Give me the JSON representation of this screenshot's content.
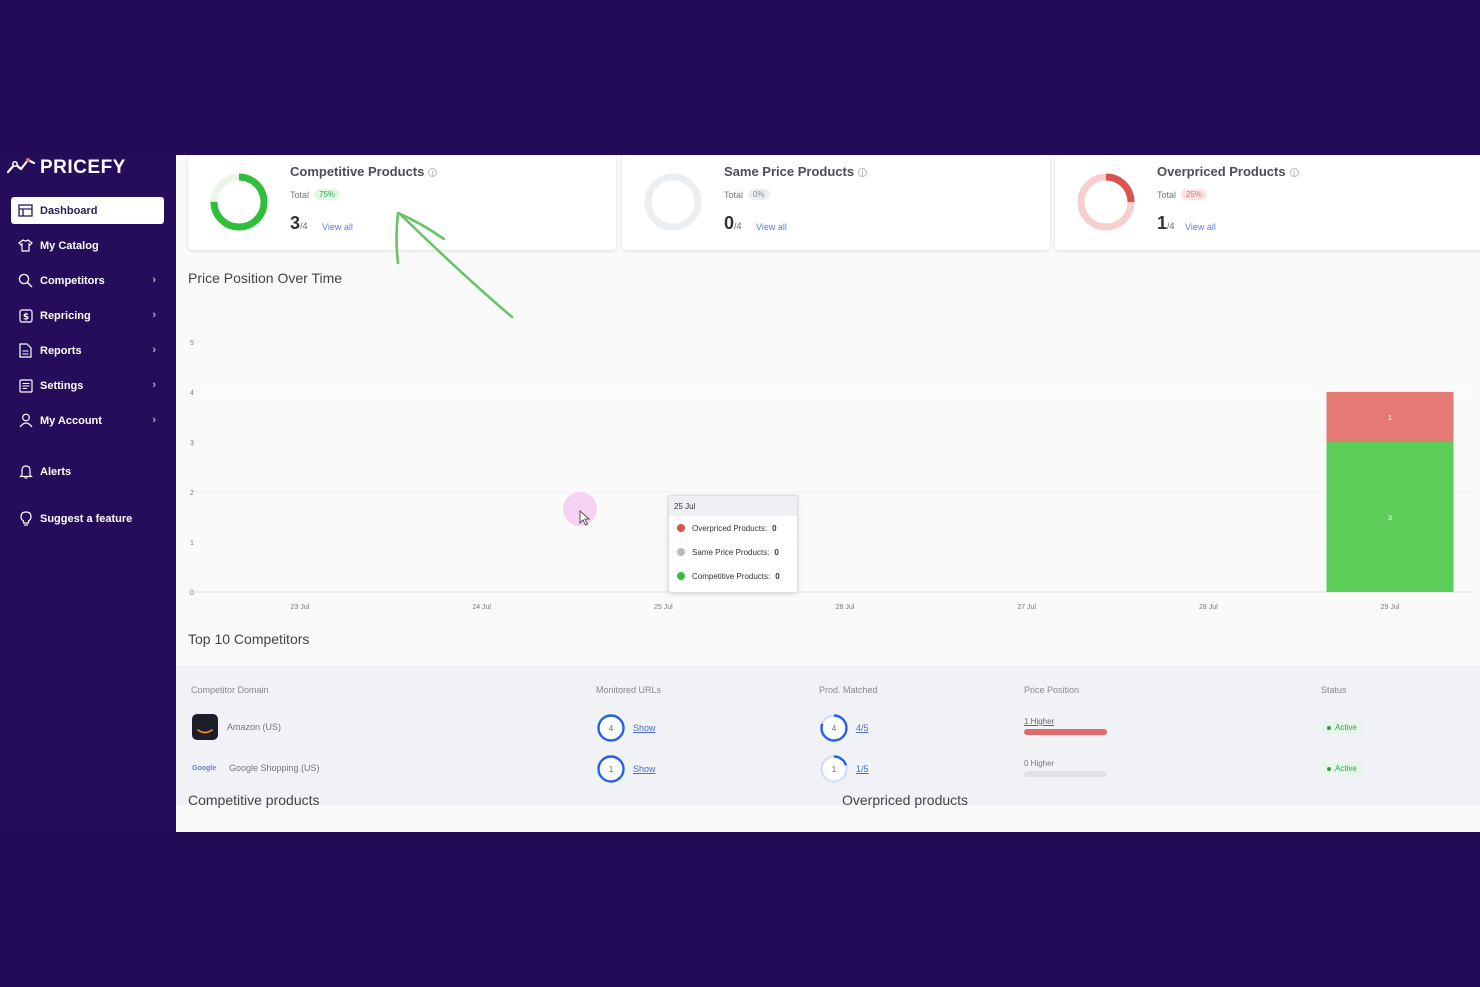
{
  "brand": {
    "name": "PRICEFY"
  },
  "sidebar": {
    "items": [
      {
        "label": "Dashboard",
        "icon": "dashboard-icon",
        "active": true,
        "chevron": false
      },
      {
        "label": "My Catalog",
        "icon": "shirt-icon",
        "chevron": false
      },
      {
        "label": "Competitors",
        "icon": "magnifier-icon",
        "chevron": true
      },
      {
        "label": "Repricing",
        "icon": "dollar-icon",
        "chevron": true
      },
      {
        "label": "Reports",
        "icon": "document-icon",
        "chevron": true
      },
      {
        "label": "Settings",
        "icon": "settings-list-icon",
        "chevron": true
      },
      {
        "label": "My Account",
        "icon": "user-icon",
        "chevron": true
      }
    ],
    "alerts": "Alerts",
    "suggest": "Suggest a feature"
  },
  "cards": [
    {
      "title": "Competitive Products",
      "total_label": "Total",
      "pct": "75%",
      "count": "3",
      "of": "/4",
      "view_all": "View all",
      "ring_fraction": 0.75,
      "color": "#2fbf3a",
      "pill_bg": "#e2f7e6",
      "pill_fg": "#3aa856"
    },
    {
      "title": "Same Price Products",
      "total_label": "Total",
      "pct": "0%",
      "count": "0",
      "of": "/4",
      "view_all": "View all",
      "ring_fraction": 0,
      "color": "#cfd3d8",
      "pill_bg": "#eceff2",
      "pill_fg": "#8a9099"
    },
    {
      "title": "Overpriced Products",
      "total_label": "Total",
      "pct": "25%",
      "count": "1",
      "of": "/4",
      "view_all": "View all",
      "ring_fraction": 0.25,
      "color": "#d9534f",
      "pill_bg": "#fde3e3",
      "pill_fg": "#e07070"
    }
  ],
  "price_position": {
    "title": "Price Position Over Time",
    "tooltip": {
      "date": "25 Jul",
      "rows": [
        {
          "label": "Overpriced Products:",
          "value": "0",
          "color": "#d9534f"
        },
        {
          "label": "Same Price Products:",
          "value": "0",
          "color": "#b7bcc4"
        },
        {
          "label": "Competitive Products:",
          "value": "0",
          "color": "#35c043"
        }
      ]
    }
  },
  "chart_data": {
    "type": "bar",
    "stacked": true,
    "categories": [
      "23 Jul",
      "24 Jul",
      "25 Jul",
      "26 Jul",
      "27 Jul",
      "28 Jul",
      "29 Jul"
    ],
    "series": [
      {
        "name": "Competitive Products",
        "values": [
          0,
          0,
          0,
          0,
          0,
          0,
          3
        ],
        "color": "#5dcd5a"
      },
      {
        "name": "Same Price Products",
        "values": [
          0,
          0,
          0,
          0,
          0,
          0,
          0
        ],
        "color": "#b7bcc4"
      },
      {
        "name": "Overpriced Products",
        "values": [
          0,
          0,
          0,
          0,
          0,
          0,
          1
        ],
        "color": "#e57a74"
      }
    ],
    "yticks": [
      "0",
      "1",
      "2",
      "3",
      "4",
      "5"
    ],
    "ylim": [
      0,
      5
    ],
    "grid": true
  },
  "competitors": {
    "title": "Top 10 Competitors",
    "headers": [
      "Competitor Domain",
      "Monitored URLs",
      "Prod. Matched",
      "Price Position",
      "Status"
    ],
    "rows": [
      {
        "logo": "amazon",
        "logo_text": "",
        "domain": "Amazon (US)",
        "urls": "4",
        "urls_link": "Show",
        "matched": "4",
        "matched_link": "4/5",
        "matched_fraction": 0.8,
        "position": "1 Higher",
        "position_fraction": 1,
        "status": "Active"
      },
      {
        "logo": "google",
        "logo_text": "Google",
        "domain": "Google Shopping (US)",
        "urls": "1",
        "urls_link": "Show",
        "matched": "1",
        "matched_link": "1/5",
        "matched_fraction": 0.2,
        "position": "0 Higher",
        "position_fraction": 0,
        "status": "Active"
      }
    ]
  },
  "bottom": {
    "competitive_title": "Competitive products",
    "overpriced_title": "Overpriced products"
  }
}
